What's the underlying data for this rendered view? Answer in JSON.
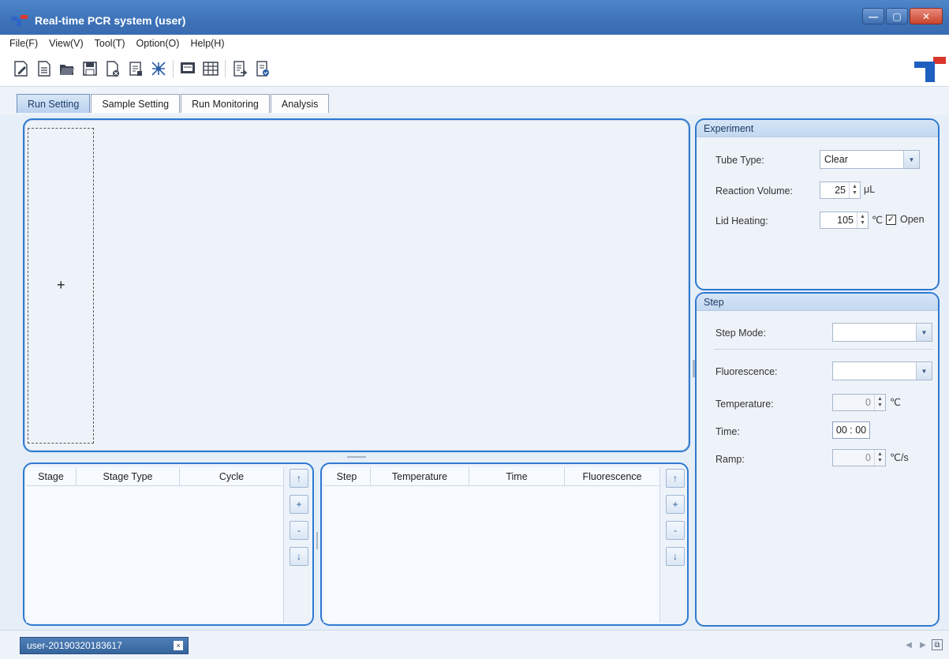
{
  "window": {
    "title": "Real-time PCR system (user)"
  },
  "menu": [
    "File(F)",
    "View(V)",
    "Tool(T)",
    "Option(O)",
    "Help(H)"
  ],
  "toolbar": {
    "icons": [
      "new-icon",
      "document-icon",
      "open-folder-icon",
      "save-icon",
      "close-document-icon",
      "properties-icon",
      "network-icon",
      "display-icon",
      "table-icon",
      "export-icon",
      "report-icon"
    ]
  },
  "tabs": [
    "Run Setting",
    "Sample Setting",
    "Run Monitoring",
    "Analysis"
  ],
  "canvas": {
    "add_stage": "+"
  },
  "stage_table": {
    "columns": [
      "Stage",
      "Stage Type",
      "Cycle"
    ],
    "buttons": [
      "↑",
      "+",
      "-",
      "↓"
    ]
  },
  "step_table": {
    "columns": [
      "Step",
      "Temperature",
      "Time",
      "Fluorescence"
    ],
    "buttons": [
      "↑",
      "+",
      "-",
      "↓"
    ]
  },
  "experiment": {
    "title": "Experiment",
    "tube_type_label": "Tube Type:",
    "tube_type_value": "Clear",
    "reaction_volume_label": "Reaction Volume:",
    "reaction_volume_value": "25",
    "reaction_volume_unit": "μL",
    "lid_heating_label": "Lid Heating:",
    "lid_heating_value": "105",
    "lid_heating_unit": "℃",
    "lid_open_label": "Open",
    "lid_open_checked": "✓"
  },
  "step": {
    "title": "Step",
    "step_mode_label": "Step Mode:",
    "step_mode_value": "",
    "fluorescence_label": "Fluorescence:",
    "fluorescence_value": "",
    "temperature_label": "Temperature:",
    "temperature_value": "0",
    "temperature_unit": "℃",
    "time_label": "Time:",
    "time_value": "00 : 00",
    "ramp_label": "Ramp:",
    "ramp_value": "0",
    "ramp_unit": "℃/s"
  },
  "doc_tab": {
    "label": "user-20190320183617",
    "close": "×"
  },
  "colors": {
    "titlebar": "#3d72b8",
    "accent": "#2e7ad1",
    "panel_bg": "#eef3fa"
  }
}
